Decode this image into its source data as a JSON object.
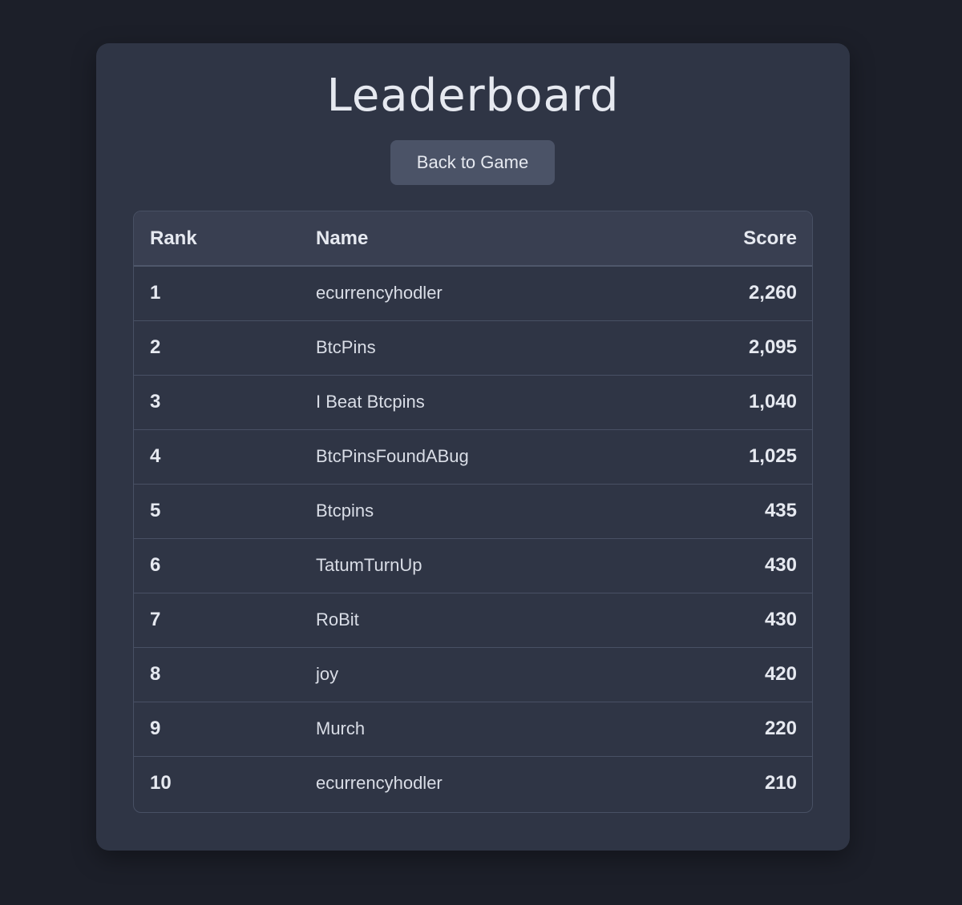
{
  "page": {
    "title": "Leaderboard",
    "back_button_label": "Back to Game"
  },
  "table": {
    "headers": {
      "rank": "Rank",
      "name": "Name",
      "score": "Score"
    },
    "rows": [
      {
        "rank": "1",
        "name": "ecurrencyhodler",
        "score": "2,260"
      },
      {
        "rank": "2",
        "name": "BtcPins",
        "score": "2,095"
      },
      {
        "rank": "3",
        "name": "I Beat Btcpins",
        "score": "1,040"
      },
      {
        "rank": "4",
        "name": "BtcPinsFoundABug",
        "score": "1,025"
      },
      {
        "rank": "5",
        "name": "Btcpins",
        "score": "435"
      },
      {
        "rank": "6",
        "name": "TatumTurnUp",
        "score": "430"
      },
      {
        "rank": "7",
        "name": "RoBit",
        "score": "430"
      },
      {
        "rank": "8",
        "name": "joy",
        "score": "420"
      },
      {
        "rank": "9",
        "name": "Murch",
        "score": "220"
      },
      {
        "rank": "10",
        "name": "ecurrencyhodler",
        "score": "210"
      }
    ]
  },
  "colors": {
    "background": "#1c1f29",
    "card": "#2f3545",
    "header_row": "#393f51",
    "button": "#4b5367",
    "text": "#e6e9f0"
  }
}
